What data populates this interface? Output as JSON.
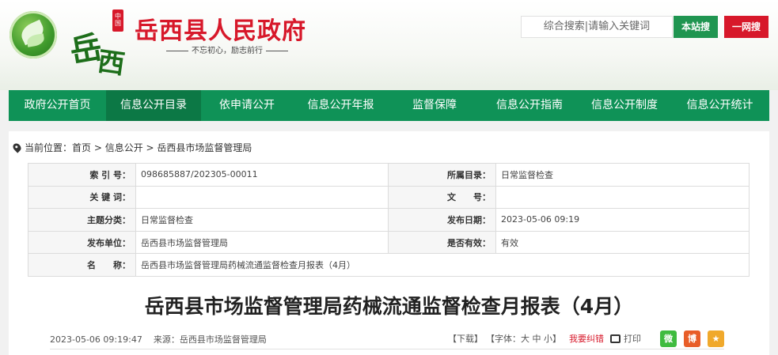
{
  "header": {
    "seal_text": "中国",
    "calligraphy_1": "岳",
    "calligraphy_2": "西",
    "site_title": "岳西县人民政府",
    "slogan": "不忘初心，励志前行",
    "search_placeholder": "综合搜索|请输入关键词",
    "btn_site": "本站搜",
    "btn_web": "一网搜"
  },
  "nav": {
    "items": [
      {
        "label": "政府公开首页"
      },
      {
        "label": "信息公开目录"
      },
      {
        "label": "依申请公开"
      },
      {
        "label": "信息公开年报"
      },
      {
        "label": "监督保障"
      },
      {
        "label": "信息公开指南"
      },
      {
        "label": "信息公开制度"
      },
      {
        "label": "信息公开统计"
      }
    ]
  },
  "breadcrumb": {
    "prefix": "当前位置：",
    "items": [
      "首页",
      "信息公开",
      "岳西县市场监督管理局"
    ],
    "separator": " > "
  },
  "meta": {
    "index_no_label": "索 引 号：",
    "index_no": "098685887/202305-00011",
    "catalog_label": "所属目录：",
    "catalog": "日常监督检查",
    "keywords_label": "关 键 词：",
    "keywords": "",
    "doc_no_label": "文　　号：",
    "doc_no": "",
    "topic_label": "主题分类：",
    "topic": "日常监督检查",
    "date_label": "发布日期：",
    "date": "2023-05-06 09:19",
    "publisher_label": "发布单位：",
    "publisher": "岳西县市场监督管理局",
    "valid_label": "是否有效：",
    "valid": "有效",
    "name_label": "名　　称：",
    "name": "岳西县市场监督管理局药械流通监督检查月报表（4月）"
  },
  "article": {
    "title": "岳西县市场监督管理局药械流通监督检查月报表（4月）",
    "datetime": "2023-05-06 09:19:47",
    "source": "来源：岳西县市场监督管理局",
    "download": "【下载】",
    "font_prefix": "【字体：",
    "font_large": "大",
    "font_medium": "中",
    "font_small": "小",
    "font_suffix": "】",
    "correction": "我要纠错",
    "print": "打印",
    "wechat_glyph": "微",
    "weibo_glyph": "博",
    "fav_glyph": "★"
  }
}
